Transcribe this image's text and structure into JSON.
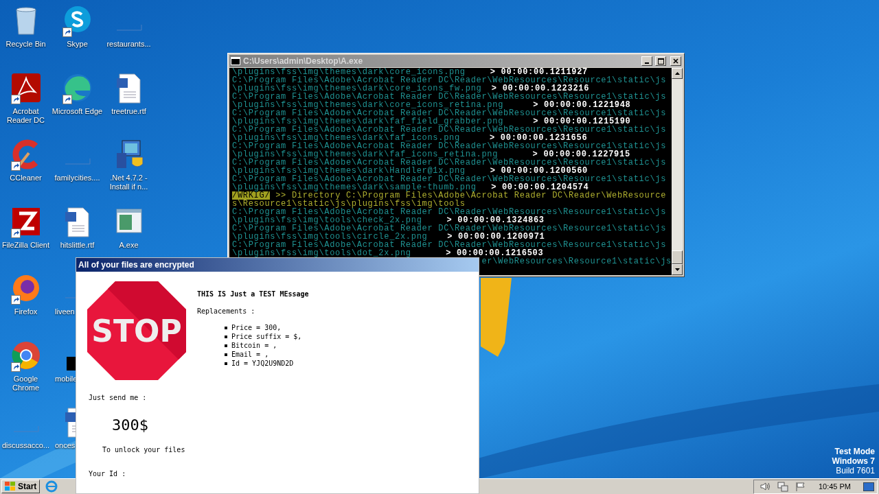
{
  "desktop_icons": [
    {
      "label": "Recycle Bin",
      "kind": "recycle",
      "shortcut": false,
      "cut_off": false
    },
    {
      "label": "Acrobat Reader DC",
      "kind": "acrobat",
      "shortcut": true,
      "cut_off": false
    },
    {
      "label": "CCleaner",
      "kind": "ccleaner",
      "shortcut": true,
      "cut_off": false
    },
    {
      "label": "FileZilla Client",
      "kind": "filezilla",
      "shortcut": true,
      "cut_off": false
    },
    {
      "label": "Firefox",
      "kind": "firefox",
      "shortcut": true,
      "cut_off": false
    },
    {
      "label": "Google Chrome",
      "kind": "chrome",
      "shortcut": true,
      "cut_off": false
    },
    {
      "label": "discussacco...",
      "kind": "blank",
      "shortcut": false,
      "cut_off": false
    },
    {
      "label": "Skype",
      "kind": "skype",
      "shortcut": true,
      "cut_off": false
    },
    {
      "label": "Microsoft Edge",
      "kind": "edge",
      "shortcut": true,
      "cut_off": false
    },
    {
      "label": "familycities....",
      "kind": "blank",
      "shortcut": false,
      "cut_off": false
    },
    {
      "label": "hitslittle.rtf",
      "kind": "word",
      "shortcut": false,
      "cut_off": false
    },
    {
      "label": "liveen",
      "kind": "blank",
      "shortcut": false,
      "cut_off": true
    },
    {
      "label": "mobile",
      "kind": "black",
      "shortcut": false,
      "cut_off": true
    },
    {
      "label": "onces",
      "kind": "word",
      "shortcut": false,
      "cut_off": true
    },
    {
      "label": "restaurants...",
      "kind": "blank",
      "shortcut": false,
      "cut_off": false
    },
    {
      "label": "treetrue.rtf",
      "kind": "word",
      "shortcut": false,
      "cut_off": false
    },
    {
      "label": ".Net 4.7.2 - Install if n...",
      "kind": "installer",
      "shortcut": false,
      "cut_off": false
    },
    {
      "label": "A.exe",
      "kind": "exe",
      "shortcut": false,
      "cut_off": false
    }
  ],
  "test_mode_notice": [
    {
      "text": "Test Mode",
      "bold": true
    },
    {
      "text": "Windows 7",
      "bold": true
    },
    {
      "text": "Build 7601",
      "bold": false
    }
  ],
  "console": {
    "title": "C:\\Users\\admin\\Desktop\\A.exe",
    "lines": [
      {
        "kind": "entry",
        "text": "\\plugins\\fss\\img\\themes\\dark\\core_icons.png",
        "time": "> 00:00:00.1211927"
      },
      {
        "kind": "path",
        "text": "C:\\Program Files\\Adobe\\Acrobat Reader DC\\Reader\\WebResources\\Resource1\\static\\js"
      },
      {
        "kind": "entry",
        "text": "\\plugins\\fss\\img\\themes\\dark\\core_icons_fw.png",
        "time": "> 00:00:00.1223216"
      },
      {
        "kind": "path",
        "text": "C:\\Program Files\\Adobe\\Acrobat Reader DC\\Reader\\WebResources\\Resource1\\static\\js"
      },
      {
        "kind": "entry",
        "text": "\\plugins\\fss\\img\\themes\\dark\\core_icons_retina.png",
        "time": "> 00:00:00.1221948"
      },
      {
        "kind": "path",
        "text": "C:\\Program Files\\Adobe\\Acrobat Reader DC\\Reader\\WebResources\\Resource1\\static\\js"
      },
      {
        "kind": "entry",
        "text": "\\plugins\\fss\\img\\themes\\dark\\faf_field_grabber.png",
        "time": "> 00:00:00.1215190"
      },
      {
        "kind": "path",
        "text": "C:\\Program Files\\Adobe\\Acrobat Reader DC\\Reader\\WebResources\\Resource1\\static\\js"
      },
      {
        "kind": "entry",
        "text": "\\plugins\\fss\\img\\themes\\dark\\faf_icons.png",
        "time": "> 00:00:00.1231656"
      },
      {
        "kind": "path",
        "text": "C:\\Program Files\\Adobe\\Acrobat Reader DC\\Reader\\WebResources\\Resource1\\static\\js"
      },
      {
        "kind": "entry",
        "text": "\\plugins\\fss\\img\\themes\\dark\\faf_icons_retina.png",
        "time": "> 00:00:00.1227915"
      },
      {
        "kind": "path",
        "text": "C:\\Program Files\\Adobe\\Acrobat Reader DC\\Reader\\WebResources\\Resource1\\static\\js"
      },
      {
        "kind": "entry",
        "text": "\\plugins\\fss\\img\\themes\\dark\\Handler@1x.png",
        "time": "> 00:00:00.1200560"
      },
      {
        "kind": "path",
        "text": "C:\\Program Files\\Adobe\\Acrobat Reader DC\\Reader\\WebResources\\Resource1\\static\\js"
      },
      {
        "kind": "entry",
        "text": "\\plugins\\fss\\img\\themes\\dark\\sample-thumb.png",
        "time": "> 00:00:00.1204574"
      },
      {
        "kind": "warn",
        "tag": "/WRKIG/",
        "text": " >> Directory C:\\Program Files\\Adobe\\Acrobat Reader DC\\Reader\\WebResource"
      },
      {
        "kind": "warn_cont",
        "text": "s\\Resource1\\static\\js\\plugins\\fss\\img\\tools"
      },
      {
        "kind": "path",
        "text": "C:\\Program Files\\Adobe\\Acrobat Reader DC\\Reader\\WebResources\\Resource1\\static\\js"
      },
      {
        "kind": "entry",
        "text": "\\plugins\\fss\\img\\tools\\check_2x.png",
        "time": "> 00:00:00.1324863"
      },
      {
        "kind": "path",
        "text": "C:\\Program Files\\Adobe\\Acrobat Reader DC\\Reader\\WebResources\\Resource1\\static\\js"
      },
      {
        "kind": "entry",
        "text": "\\plugins\\fss\\img\\tools\\circle_2x.png",
        "time": "> 00:00:00.1200971"
      },
      {
        "kind": "path",
        "text": "C:\\Program Files\\Adobe\\Acrobat Reader DC\\Reader\\WebResources\\Resource1\\static\\js"
      },
      {
        "kind": "entry",
        "text": "\\plugins\\fss\\img\\tools\\dot_2x.png",
        "time": "> 00:00:00.1216503"
      },
      {
        "kind": "tail",
        "text": "er\\WebResources\\Resource1\\static\\js"
      }
    ]
  },
  "ransom_window": {
    "title": "All of your files are encrypted",
    "heading": "THIS IS Just a TEST MEssage",
    "sign_text": "STOP",
    "replacements_label": "Replacements :",
    "replacements": [
      "Price = 300,",
      "Price suffix = $,",
      "Bitcoin = ,",
      "Email = ,",
      "Id = YJQ2U9ND2D"
    ],
    "send_label": "Just send me :",
    "amount": "300$",
    "unlock_text": "To unlock your files",
    "id_label": "Your Id :"
  },
  "taskbar": {
    "start_label": "Start",
    "clock": "10:45 PM"
  }
}
